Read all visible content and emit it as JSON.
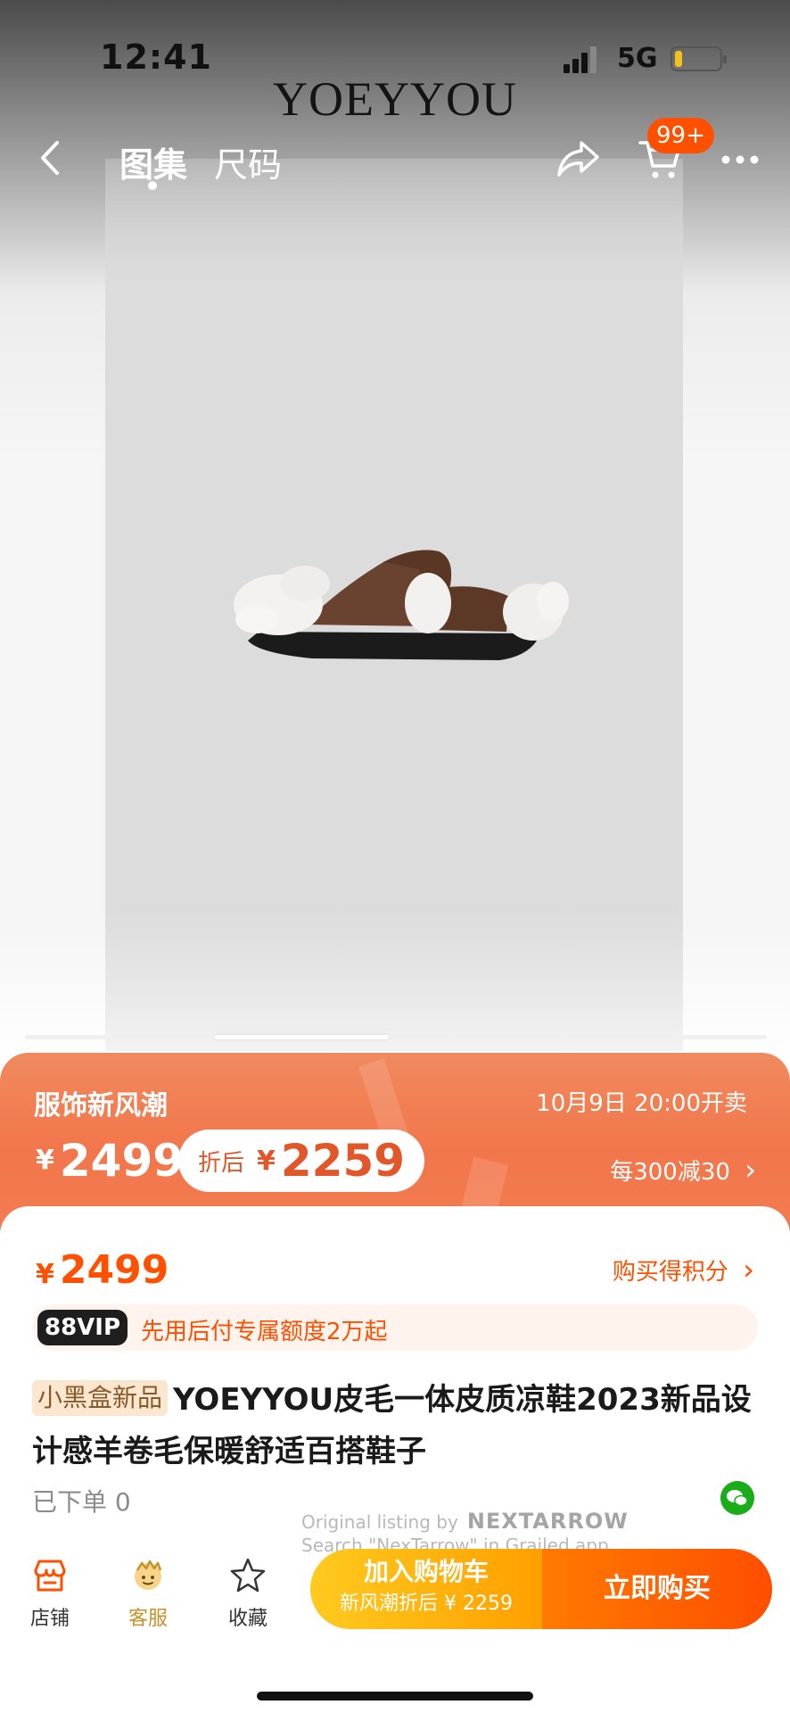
{
  "status_bar": {
    "time": "12:41",
    "network": "5G",
    "battery_level": 0.15,
    "battery_color": "#f2c21b"
  },
  "header": {
    "brand": "YOEYYOU",
    "tabs": [
      {
        "label": "图集",
        "active": true
      },
      {
        "label": "尺码",
        "active": false
      }
    ],
    "cart_badge": "99+",
    "icons": {
      "back": "chevron-left-icon",
      "share": "share-icon",
      "cart": "cart-icon",
      "more": "more-icon"
    }
  },
  "gallery": {
    "page_count": 4,
    "active_page": 2,
    "image": "fur-trimmed-brown-leather-slide-sandal"
  },
  "promo": {
    "title": "服饰新风潮",
    "sale_start": "10月9日 20:00开卖",
    "currency": "¥",
    "price": "2499",
    "discount_label": "折后",
    "discount_price": "2259",
    "rule": "每300减30",
    "rule_arrow": "›",
    "bg_color": "#f2764b"
  },
  "product": {
    "currency": "¥",
    "price": "2499",
    "points_link": "购买得积分",
    "points_arrow": "›",
    "vip_badge": "88VIP",
    "vip_text": "先用后付专属额度2万起",
    "tag": "小黑盒新品",
    "title": "YOEYYOU皮毛一体皮质凉鞋2023新品设计感羊卷毛保暖舒适百搭鞋子",
    "sold": "已下单 0",
    "accent_color": "#ff5000"
  },
  "watermark": {
    "line1": "Original listing by",
    "brand": "NEXTARROW",
    "line2": "Search \"NexTarrow\" in Grailed app"
  },
  "bottom_bar": {
    "store": "店铺",
    "service": "客服",
    "favorite": "收藏",
    "add_to_cart": "加入购物车",
    "add_to_cart_sub": "新风潮折后 ¥ 2259",
    "buy_now": "立即购买"
  }
}
